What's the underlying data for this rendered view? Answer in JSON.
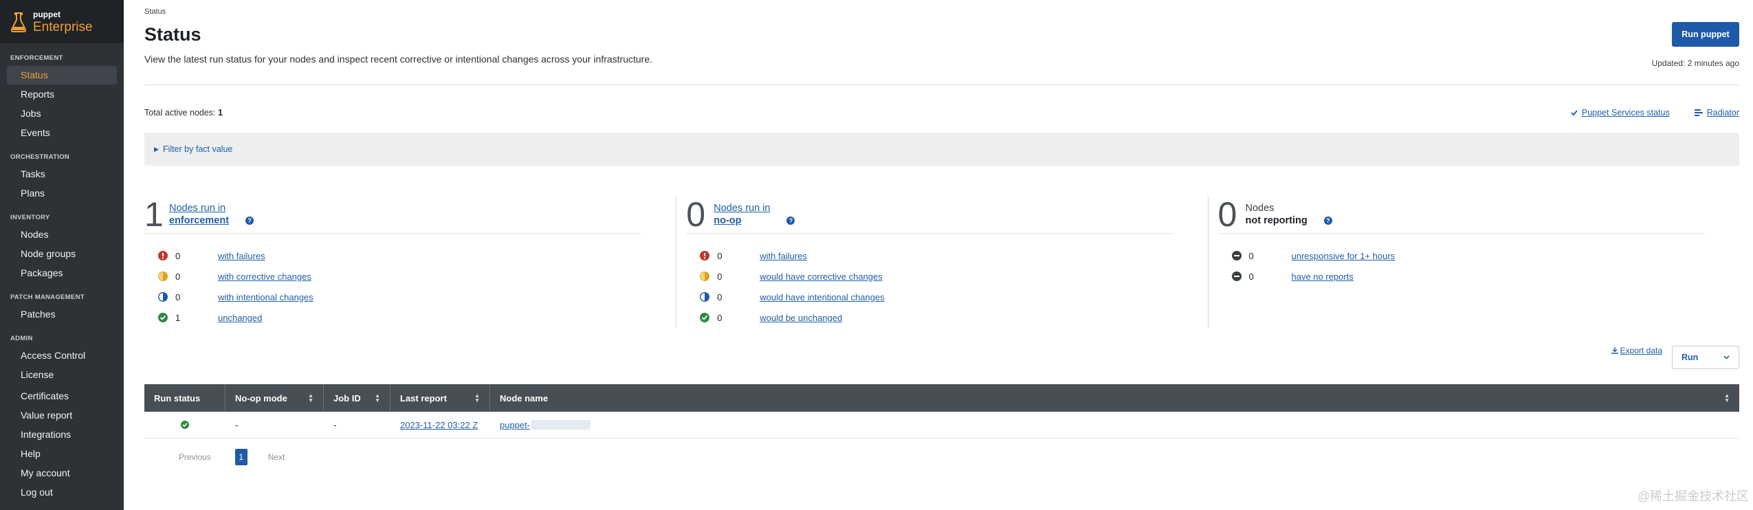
{
  "brand": {
    "small": "puppet",
    "big": "Enterprise"
  },
  "sidebar": {
    "sections": [
      {
        "heading": "ENFORCEMENT",
        "items": [
          "Status",
          "Reports",
          "Jobs",
          "Events"
        ]
      },
      {
        "heading": "ORCHESTRATION",
        "items": [
          "Tasks",
          "Plans"
        ]
      },
      {
        "heading": "INVENTORY",
        "items": [
          "Nodes",
          "Node groups",
          "Packages"
        ]
      },
      {
        "heading": "PATCH MANAGEMENT",
        "items": [
          "Patches"
        ]
      },
      {
        "heading": "ADMIN",
        "items": [
          "Access Control",
          "License",
          "Certificates",
          "Value report",
          "Integrations",
          "Help",
          "My account",
          "Log out"
        ]
      }
    ],
    "active": "Status"
  },
  "header": {
    "breadcrumb": "Status",
    "title": "Status",
    "subtitle": "View the latest run status for your nodes and inspect recent corrective or intentional changes across your infrastructure.",
    "run_button": "Run puppet",
    "updated": "Updated: 2 minutes ago"
  },
  "summary": {
    "total_label": "Total active nodes:",
    "total_value": "1",
    "services_link": "Puppet Services status",
    "radiator_link": "Radiator"
  },
  "filter": {
    "label": "Filter by fact value"
  },
  "columns": {
    "enforcement": {
      "count": "1",
      "line1": "Nodes run in",
      "line2": "enforcement",
      "rows": [
        {
          "icon": "failure-icon",
          "count": "0",
          "label": "with failures"
        },
        {
          "icon": "corrective-icon",
          "count": "0",
          "label": "with corrective changes"
        },
        {
          "icon": "intentional-icon",
          "count": "0",
          "label": "with intentional changes"
        },
        {
          "icon": "unchanged-icon",
          "count": "1",
          "label": "unchanged"
        }
      ]
    },
    "noop": {
      "count": "0",
      "line1": "Nodes run in",
      "line2": "no-op",
      "rows": [
        {
          "icon": "failure-icon",
          "count": "0",
          "label": "with failures"
        },
        {
          "icon": "corrective-icon",
          "count": "0",
          "label": "would have corrective changes"
        },
        {
          "icon": "intentional-icon",
          "count": "0",
          "label": "would have intentional changes"
        },
        {
          "icon": "unchanged-icon",
          "count": "0",
          "label": "would be unchanged"
        }
      ]
    },
    "not_reporting": {
      "count": "0",
      "line1": "Nodes",
      "line2": "not reporting",
      "rows": [
        {
          "icon": "unresponsive-icon",
          "count": "0",
          "label": "unresponsive for 1+ hours"
        },
        {
          "icon": "no-report-icon",
          "count": "0",
          "label": "have no reports"
        }
      ]
    }
  },
  "table_controls": {
    "export": "Export data",
    "run_select": "Run"
  },
  "table": {
    "headers": [
      "Run status",
      "No-op mode",
      "Job ID",
      "Last report",
      "Node name"
    ],
    "rows": [
      {
        "noop": "-",
        "job_id": "-",
        "last_report": "2023-11-22 03:22 Z",
        "node_name": "puppet-"
      }
    ]
  },
  "pager": {
    "previous": "Previous",
    "page": "1",
    "next": "Next"
  },
  "watermark": "@稀土掘金技术社区",
  "colors": {
    "accent": "#1e5aa8",
    "brand": "#f0a030",
    "sidebar": "#2e3236",
    "success": "#2e8b3e",
    "failure": "#c0392b",
    "warning": "#e0a020"
  }
}
